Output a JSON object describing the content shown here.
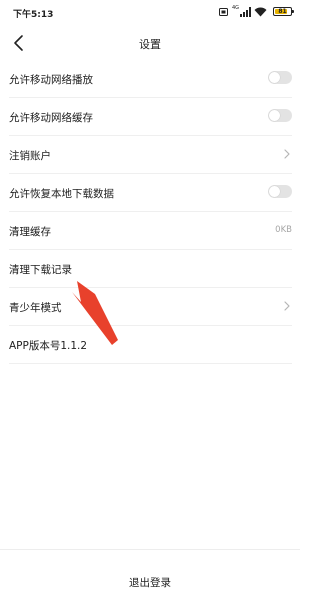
{
  "status_bar": {
    "time": "下午5:13",
    "signal_label": "4G",
    "battery_level": "81",
    "battery_fraction": 0.81
  },
  "header": {
    "title": "设置"
  },
  "settings": [
    {
      "label": "允许移动网络播放",
      "control": "toggle",
      "checked": false
    },
    {
      "label": "允许移动网络缓存",
      "control": "toggle",
      "checked": false
    },
    {
      "label": "注销账户",
      "control": "chevron"
    },
    {
      "label": "允许恢复本地下载数据",
      "control": "toggle",
      "checked": false
    },
    {
      "label": "清理缓存",
      "control": "value",
      "value": "0KB"
    },
    {
      "label": "清理下载记录",
      "control": "none"
    },
    {
      "label": "青少年模式",
      "control": "chevron"
    },
    {
      "label": "APP版本号1.1.2",
      "control": "none"
    }
  ],
  "logout": {
    "label": "退出登录"
  },
  "colors": {
    "accent_arrow": "#e8412c",
    "toggle_off": "#e3e3e3",
    "divider": "#efefef",
    "battery": "#e8b400"
  },
  "icons": {
    "back": "chevron-left-icon",
    "row_chevron": "chevron-right-icon"
  }
}
